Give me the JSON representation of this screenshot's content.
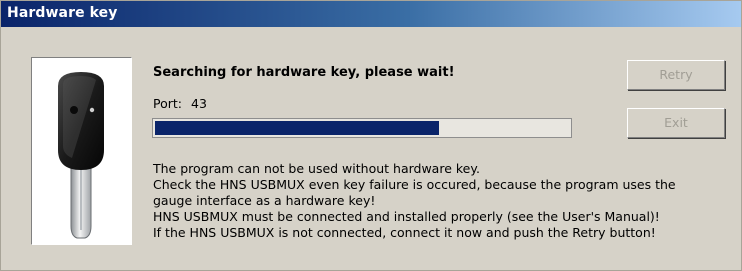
{
  "window": {
    "title": "Hardware key"
  },
  "status": {
    "heading": "Searching for hardware key, please wait!",
    "port_label": "Port:",
    "port_value": "43"
  },
  "progress": {
    "fraction": 0.685,
    "color": "#0a246a"
  },
  "buttons": {
    "retry_label": "Retry",
    "exit_label": "Exit",
    "enabled": false
  },
  "message_lines": [
    "The program can not be used without hardware key.",
    "Check the HNS USBMUX even key failure is occured, because the program uses the",
    "gauge interface as a hardware key!",
    "HNS USBMUX must be connected and installed properly (see the User's Manual)!",
    "If the HNS USBMUX is not connected, connect it now and push the Retry button!"
  ],
  "icons": {
    "key": "usb-key-icon"
  }
}
